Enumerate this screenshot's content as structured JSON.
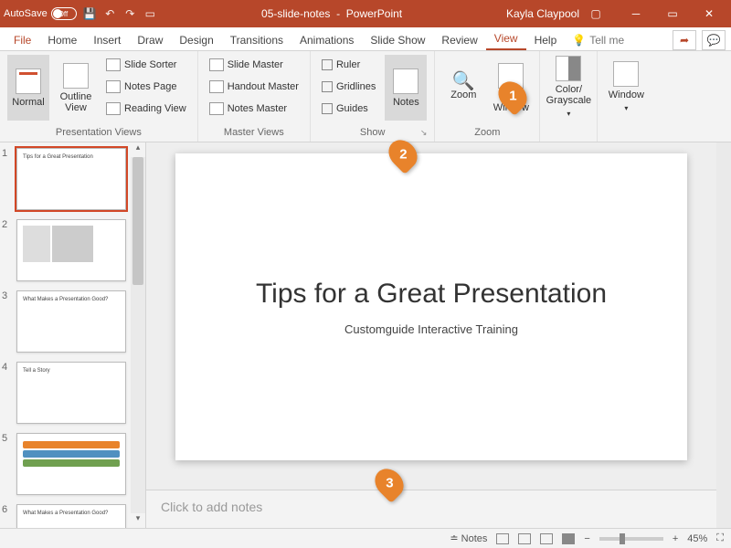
{
  "titlebar": {
    "autosave": "AutoSave",
    "autosave_state": "Off",
    "filename": "05-slide-notes",
    "app": "PowerPoint",
    "user": "Kayla Claypool"
  },
  "tabs": {
    "file": "File",
    "items": [
      "Home",
      "Insert",
      "Draw",
      "Design",
      "Transitions",
      "Animations",
      "Slide Show",
      "Review",
      "View",
      "Help"
    ],
    "active": "View",
    "tellme": "Tell me"
  },
  "ribbon": {
    "presentation_views": {
      "label": "Presentation Views",
      "normal": "Normal",
      "outline": "Outline View",
      "slide_sorter": "Slide Sorter",
      "notes_page": "Notes Page",
      "reading_view": "Reading View"
    },
    "master_views": {
      "label": "Master Views",
      "slide_master": "Slide Master",
      "handout_master": "Handout Master",
      "notes_master": "Notes Master"
    },
    "show": {
      "label": "Show",
      "ruler": "Ruler",
      "gridlines": "Gridlines",
      "guides": "Guides",
      "notes": "Notes"
    },
    "zoom": {
      "label": "Zoom",
      "zoom_btn": "Zoom",
      "fit": "Fit to Window"
    },
    "color": {
      "label": "Color/ Grayscale"
    },
    "window": {
      "label": "Window"
    }
  },
  "slide": {
    "title": "Tips for a Great Presentation",
    "subtitle": "Customguide Interactive Training"
  },
  "notes": {
    "placeholder": "Click to add notes"
  },
  "status": {
    "notes": "Notes",
    "zoom": "45%"
  },
  "callouts": [
    "1",
    "2",
    "3"
  ],
  "thumbs": [
    "1",
    "2",
    "3",
    "4",
    "5",
    "6"
  ]
}
